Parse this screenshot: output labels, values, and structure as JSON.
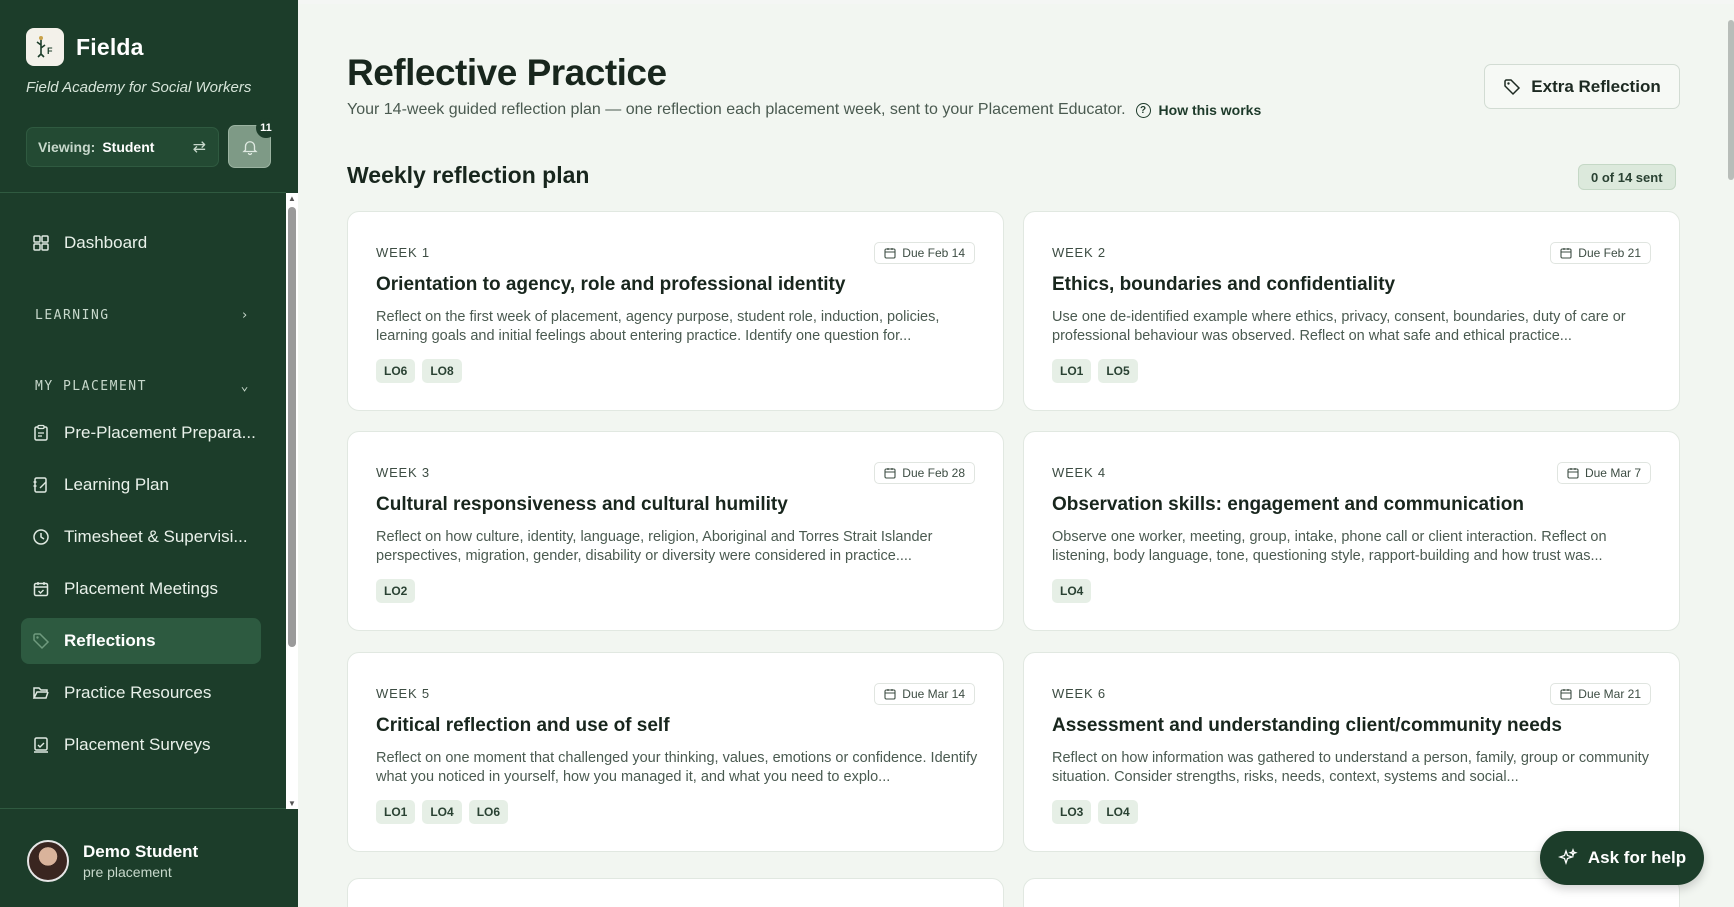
{
  "app": {
    "name": "Fielda",
    "tagline": "Field Academy for Social Workers",
    "viewing_label": "Viewing:",
    "viewing_value": "Student",
    "notification_count": "11"
  },
  "sidebar": {
    "dashboard": "Dashboard",
    "learning_section": "LEARNING",
    "placement_section": "MY PLACEMENT",
    "items": [
      {
        "label": "Pre-Placement Prepara...",
        "icon": "clipboard-icon"
      },
      {
        "label": "Learning Plan",
        "icon": "notebook-pen-icon"
      },
      {
        "label": "Timesheet & Supervisi...",
        "icon": "clock-icon"
      },
      {
        "label": "Placement Meetings",
        "icon": "calendar-check-icon"
      },
      {
        "label": "Reflections",
        "icon": "tag-icon",
        "active": true
      },
      {
        "label": "Practice Resources",
        "icon": "folder-open-icon"
      },
      {
        "label": "Placement Surveys",
        "icon": "survey-icon"
      }
    ],
    "user": {
      "name": "Demo Student",
      "status": "pre placement"
    }
  },
  "header": {
    "title": "Reflective Practice",
    "subtitle": "Your 14-week guided reflection plan — one reflection each placement week, sent to your Placement Educator.",
    "how_link": "How this works",
    "extra_button": "Extra Reflection"
  },
  "plan": {
    "title": "Weekly reflection plan",
    "sent_status": "0 of 14 sent",
    "weeks": [
      {
        "week": "WEEK 1",
        "due": "Due Feb 14",
        "title": "Orientation to agency, role and professional identity",
        "desc": "Reflect on the first week of placement, agency purpose, student role, induction, policies, learning goals and initial feelings about entering practice. Identify one question for...",
        "tags": [
          "LO6",
          "LO8"
        ]
      },
      {
        "week": "WEEK 2",
        "due": "Due Feb 21",
        "title": "Ethics, boundaries and confidentiality",
        "desc": "Use one de-identified example where ethics, privacy, consent, boundaries, duty of care or professional behaviour was observed. Reflect on what safe and ethical practice...",
        "tags": [
          "LO1",
          "LO5"
        ]
      },
      {
        "week": "WEEK 3",
        "due": "Due Feb 28",
        "title": "Cultural responsiveness and cultural humility",
        "desc": "Reflect on how culture, identity, language, religion, Aboriginal and Torres Strait Islander perspectives, migration, gender, disability or diversity were considered in practice....",
        "tags": [
          "LO2"
        ]
      },
      {
        "week": "WEEK 4",
        "due": "Due Mar 7",
        "title": "Observation skills: engagement and communication",
        "desc": "Observe one worker, meeting, group, intake, phone call or client interaction. Reflect on listening, body language, tone, questioning style, rapport-building and how trust was...",
        "tags": [
          "LO4"
        ]
      },
      {
        "week": "WEEK 5",
        "due": "Due Mar 14",
        "title": "Critical reflection and use of self",
        "desc": "Reflect on one moment that challenged your thinking, values, emotions or confidence. Identify what you noticed in yourself, how you managed it, and what you need to explo...",
        "tags": [
          "LO1",
          "LO4",
          "LO6"
        ]
      },
      {
        "week": "WEEK 6",
        "due": "Due Mar 21",
        "title": "Assessment and understanding client/community needs",
        "desc": "Reflect on how information was gathered to understand a person, family, group or community situation. Consider strengths, risks, needs, context, systems and social...",
        "tags": [
          "LO3",
          "LO4"
        ]
      }
    ]
  },
  "help_button": "Ask for help",
  "colors": {
    "sidebar": "#1c3d2a",
    "accent": "#2d5a40",
    "background": "#f2f6f1"
  }
}
